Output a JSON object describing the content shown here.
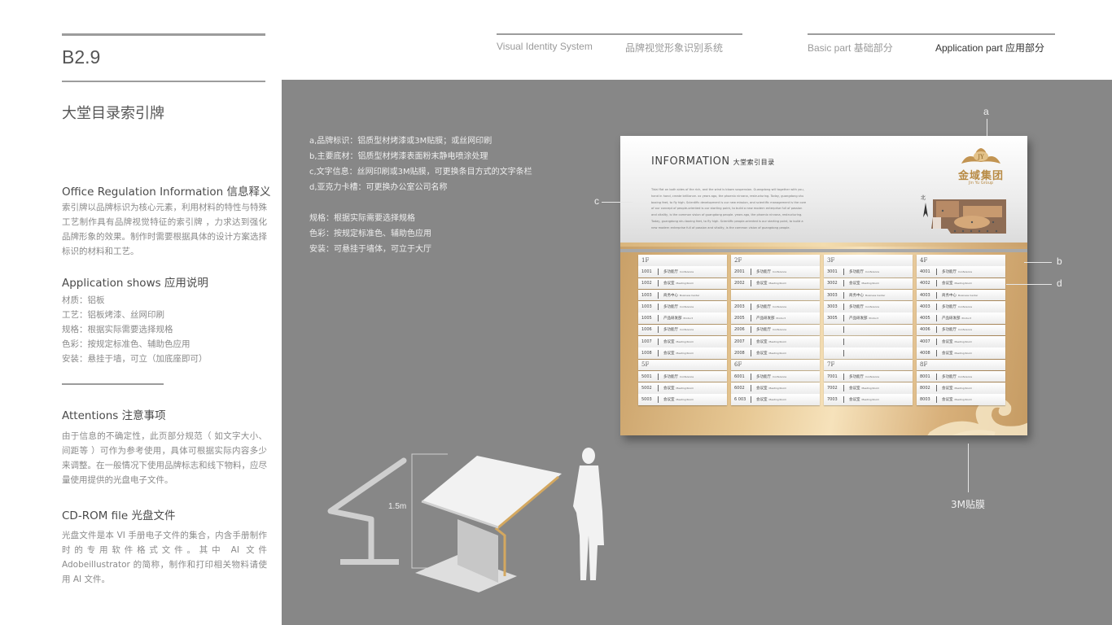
{
  "header": {
    "code": "B2.9",
    "system_en": "Visual Identity System",
    "system_cn": "品牌视觉形象识别系统",
    "basic_part": "Basic part  基础部分",
    "application_part": "Application part  应用部分"
  },
  "page_title": "大堂目录索引牌",
  "sections": {
    "office": {
      "heading": "Office Regulation Information 信息释义",
      "body": "索引牌以品牌标识为核心元素，利用材料的特性与特殊工艺制作具有品牌视觉特征的索引牌 ，力求达到强化品牌形象的效果。制作时需要根据具体的设计方案选择标识的材料和工艺。"
    },
    "application": {
      "heading": "Application shows 应用说明",
      "items": [
        "材质：铝板",
        "工艺：铝板烤漆、丝网印刷",
        "规格：根据实际需要选择规格",
        "色彩：按规定标准色、辅助色应用",
        "安装：悬挂于墙，可立（加底座即可）"
      ]
    },
    "attentions": {
      "heading": "Attentions 注意事项",
      "body": "由于信息的不确定性，此页部分规范（ 如文字大小、间距等 ）可作为参考使用，具体可根据实际内容多少来调整。在一般情况下使用品牌标志和线下物料，应尽量使用提供的光盘电子文件。"
    },
    "cdrom": {
      "heading": "CD-ROM file 光盘文件",
      "body": "光盘文件是本 VI 手册电子文件的集合，内含手册制作时的专用软件格式文件。其中 AI 文件 Adobeillustrator 的简称，制作和打印相关物料请使用 AI 文件。"
    }
  },
  "specs": [
    "a,品牌标识：铝质型材烤漆或3M贴膜；或丝网印刷",
    "b,主要底材：铝质型材烤漆表面粉末静电喷涂处理",
    "c,文字信息：丝网印刷或3M贴膜，可更换条目方式的文字条栏",
    "d,亚克力卡槽：可更换办公室公司名称",
    "",
    "规格：根据实际需要选择规格",
    "色彩：按规定标准色、辅助色应用",
    "安装：可悬挂于墙体，可立于大厅"
  ],
  "board": {
    "title": "INFORMATION",
    "title_cn": "大堂索引目录",
    "body": "Tidal flat on both sides of the rich, and the wind is blown suspension. Guangdong will together with you, hand in hand, create brilliance. xx years ago, the phoenix nirvana, restructuring. Today, guangdong shu boxing feet, to fly high. Scientific development is our new mission, and scientific management is the core of our concept of people-oriented is our starting point, to build a new modern enterprise full of passion and vitality, is the common vision of guangdong people. years ago, the phoenix nirvana, restructuring. Today, guangdong shu boxing feet, to fly high. Scientific people-oriented is our starting point, to build a new modern enterprise full of passion and vitality, is the common vision of guangdong people.",
    "logo_cn": "金域集团",
    "logo_en": "Jin Yu Group",
    "north": "北",
    "directory": [
      [
        {
          "floor": "1F",
          "rows": [
            {
              "num": "1001",
              "cn": "多功能厅",
              "en": "Conference"
            },
            {
              "num": "1002",
              "cn": "会议室",
              "en": "Meeting Room"
            },
            {
              "num": "1003",
              "cn": "商务中心",
              "en": "Business Center"
            },
            {
              "num": "1003",
              "cn": "多功能厅",
              "en": "Conference"
            },
            {
              "num": "1005",
              "cn": "产品研发部",
              "en": "Product"
            },
            {
              "num": "1006",
              "cn": "多功能厅",
              "en": "Conference"
            },
            {
              "num": "1007",
              "cn": "会议室",
              "en": "Meeting Room"
            },
            {
              "num": "1008",
              "cn": "会议室",
              "en": "Meeting Room"
            }
          ]
        },
        {
          "floor": "5F",
          "rows": [
            {
              "num": "5001",
              "cn": "多功能厅",
              "en": "Conference"
            },
            {
              "num": "5002",
              "cn": "会议室",
              "en": "Meeting Room"
            },
            {
              "num": "5003",
              "cn": "会议室",
              "en": "Meeting Room"
            }
          ]
        }
      ],
      [
        {
          "floor": "2F",
          "rows": [
            {
              "num": "2001",
              "cn": "多功能厅",
              "en": "Conference"
            },
            {
              "num": "2002",
              "cn": "会议室",
              "en": "Meeting Room"
            },
            {
              "num": "",
              "cn": "",
              "en": ""
            },
            {
              "num": "2003",
              "cn": "多功能厅",
              "en": "Conference"
            },
            {
              "num": "2005",
              "cn": "产品研发部",
              "en": "Product"
            },
            {
              "num": "2006",
              "cn": "多功能厅",
              "en": "Conference"
            },
            {
              "num": "2007",
              "cn": "会议室",
              "en": "Meeting Room"
            },
            {
              "num": "2008",
              "cn": "会议室",
              "en": "Meeting Room"
            }
          ]
        },
        {
          "floor": "6F",
          "rows": [
            {
              "num": "6001",
              "cn": "多功能厅",
              "en": "Conference"
            },
            {
              "num": "6002",
              "cn": "会议室",
              "en": "Meeting Room"
            },
            {
              "num": "6 003",
              "cn": "会议室",
              "en": "Meeting Room"
            }
          ]
        }
      ],
      [
        {
          "floor": "3F",
          "rows": [
            {
              "num": "3001",
              "cn": "多功能厅",
              "en": "Conference"
            },
            {
              "num": "3002",
              "cn": "会议室",
              "en": "Meeting Room"
            },
            {
              "num": "3003",
              "cn": "商务中心",
              "en": "Business Center"
            },
            {
              "num": "3003",
              "cn": "多功能厅",
              "en": "Conference"
            },
            {
              "num": "3005",
              "cn": "产品研发部",
              "en": "Product"
            },
            {
              "num": "",
              "cn": "",
              "en": "",
              "sep": true
            },
            {
              "num": "",
              "cn": "",
              "en": "",
              "sep": true
            },
            {
              "num": "",
              "cn": "",
              "en": "",
              "sep": true
            }
          ]
        },
        {
          "floor": "7F",
          "rows": [
            {
              "num": "7001",
              "cn": "多功能厅",
              "en": "Conference"
            },
            {
              "num": "7002",
              "cn": "会议室",
              "en": "Meeting Room"
            },
            {
              "num": "7003",
              "cn": "会议室",
              "en": "Meeting Room"
            }
          ]
        }
      ],
      [
        {
          "floor": "4F",
          "rows": [
            {
              "num": "4001",
              "cn": "多功能厅",
              "en": "Conference"
            },
            {
              "num": "4002",
              "cn": "会议室",
              "en": "Meeting Room"
            },
            {
              "num": "4003",
              "cn": "商务中心",
              "en": "Business Center"
            },
            {
              "num": "4003",
              "cn": "多功能厅",
              "en": "Conference"
            },
            {
              "num": "4005",
              "cn": "产品研发部",
              "en": "Product"
            },
            {
              "num": "4006",
              "cn": "多功能厅",
              "en": "Conference"
            },
            {
              "num": "4007",
              "cn": "会议室",
              "en": "Meeting Room"
            },
            {
              "num": "4008",
              "cn": "会议室",
              "en": "Meeting Room"
            }
          ]
        },
        {
          "floor": "8F",
          "rows": [
            {
              "num": "8001",
              "cn": "多功能厅",
              "en": "Conference"
            },
            {
              "num": "8002",
              "cn": "会议室",
              "en": "Meeting Room"
            },
            {
              "num": "8003",
              "cn": "会议室",
              "en": "Meeting Room"
            }
          ]
        }
      ]
    ]
  },
  "callouts": {
    "a": "a",
    "b": "b",
    "c": "c",
    "d": "d"
  },
  "dimension_label": "1.5m",
  "film_label": "3M贴膜",
  "colors": {
    "stage": "#878787",
    "gold": "#c9a068",
    "rule": "#9c9c9c"
  }
}
